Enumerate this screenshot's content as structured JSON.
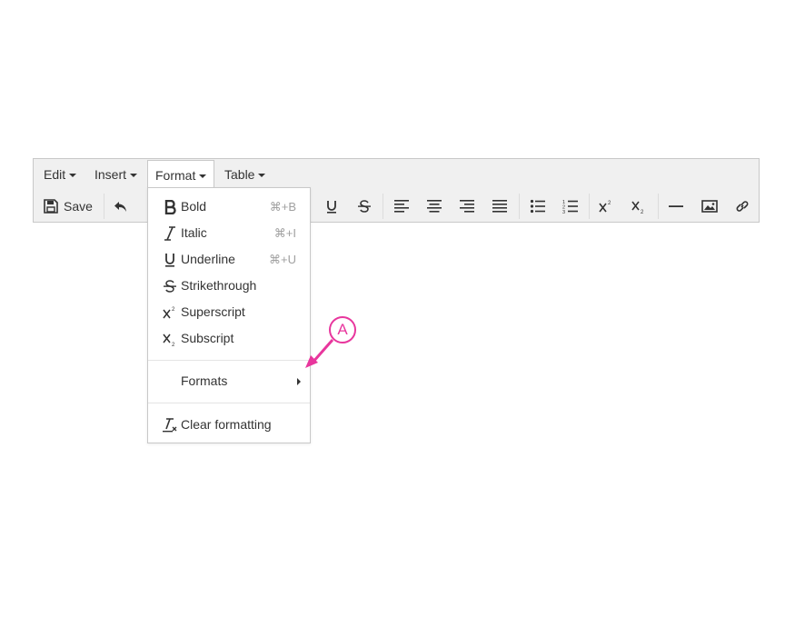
{
  "menubar": {
    "items": [
      {
        "label": "Edit"
      },
      {
        "label": "Insert"
      },
      {
        "label": "Format"
      },
      {
        "label": "Table"
      }
    ]
  },
  "toolbar": {
    "save_label": "Save",
    "icons": [
      "save-icon",
      "undo-icon",
      "underline-icon",
      "strikethrough-icon",
      "align-left-icon",
      "align-center-icon",
      "align-right-icon",
      "align-justify-icon",
      "bullet-list-icon",
      "numbered-list-icon",
      "superscript-icon",
      "subscript-icon",
      "horizontal-rule-icon",
      "image-icon",
      "link-icon"
    ]
  },
  "format_menu": {
    "items": [
      {
        "label": "Bold",
        "shortcut": "⌘+B",
        "icon": "bold-icon"
      },
      {
        "label": "Italic",
        "shortcut": "⌘+I",
        "icon": "italic-icon"
      },
      {
        "label": "Underline",
        "shortcut": "⌘+U",
        "icon": "underline-icon"
      },
      {
        "label": "Strikethrough",
        "icon": "strikethrough-icon"
      },
      {
        "label": "Superscript",
        "icon": "superscript-icon"
      },
      {
        "label": "Subscript",
        "icon": "subscript-icon"
      }
    ],
    "formats_label": "Formats",
    "clear_label": "Clear formatting"
  },
  "annotation": {
    "label": "A",
    "color": "#e8369d"
  }
}
